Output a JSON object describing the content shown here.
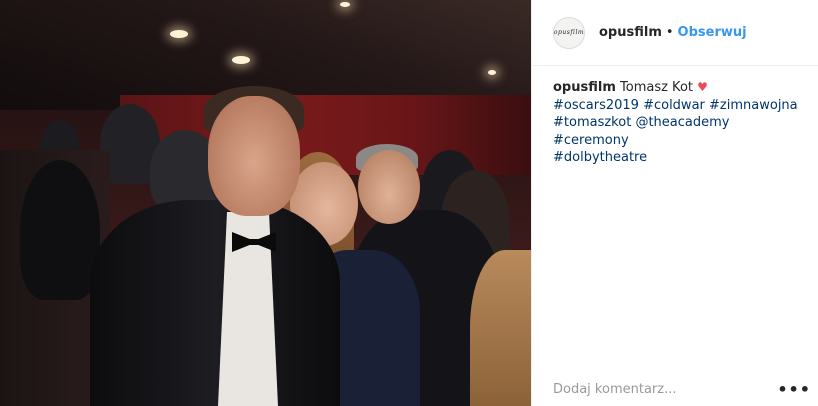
{
  "post": {
    "username": "opusfilm",
    "separator": "•",
    "follow_label": "Obserwuj",
    "avatar_text": "opusfilm",
    "caption": {
      "username": "opusfilm",
      "text": "Tomasz Kot",
      "heart": "♥",
      "tags": [
        "#oscars2019",
        "#coldwar",
        "#zimnawojna",
        "#tomaszkot",
        "@theacademy",
        "#ceremony",
        "#dolbytheatre"
      ]
    },
    "comment": {
      "placeholder": "Dodaj komentarz...",
      "more_label": "•••"
    }
  },
  "colors": {
    "link_blue": "#3897f0",
    "hashtag": "#003569",
    "heart": "#ed4956",
    "text": "#262626",
    "placeholder": "#999999"
  },
  "icons": [
    "heart-icon",
    "more-options-icon"
  ]
}
